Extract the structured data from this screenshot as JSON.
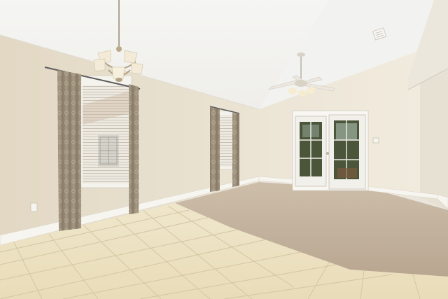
{
  "scene": {
    "kind": "photo-interior",
    "subject": "empty room",
    "colors": {
      "ceiling": "#f3f2ef",
      "wall_left": "#e4dccb",
      "wall_back": "#ece6d9",
      "wall_right": "#e7e1d3",
      "carpet": "#c6b6a1",
      "tile": "#ece2c3",
      "grout": "#d3c7a5",
      "curtain": "#9a8d79",
      "baseboard": "#f6f4ef",
      "door_frame": "#f8f7f3",
      "glass": "#46513a",
      "chandelier": "#f3ead7",
      "fan": "#ece8e0"
    },
    "icons": {
      "chandelier": "chandelier-icon",
      "ceiling_fan": "ceiling-fan-icon",
      "vent": "air-vent-icon",
      "outlet": "power-outlet-icon",
      "switch": "light-switch-icon"
    }
  }
}
